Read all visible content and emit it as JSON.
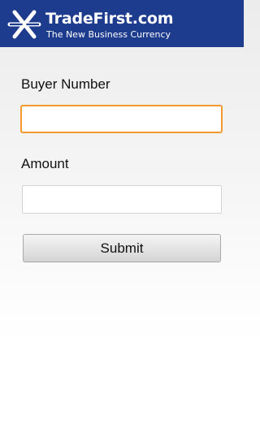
{
  "header": {
    "logo_icon": "tradefirst-logo-icon",
    "brand_name": "TradeFirst.com",
    "tagline": "The New Business Currency",
    "background_color": "#1e3c8e"
  },
  "form": {
    "buyer_number": {
      "label": "Buyer Number",
      "value": "",
      "focused": true,
      "focus_color": "#f29a2e"
    },
    "amount": {
      "label": "Amount",
      "value": ""
    },
    "submit_label": "Submit"
  }
}
